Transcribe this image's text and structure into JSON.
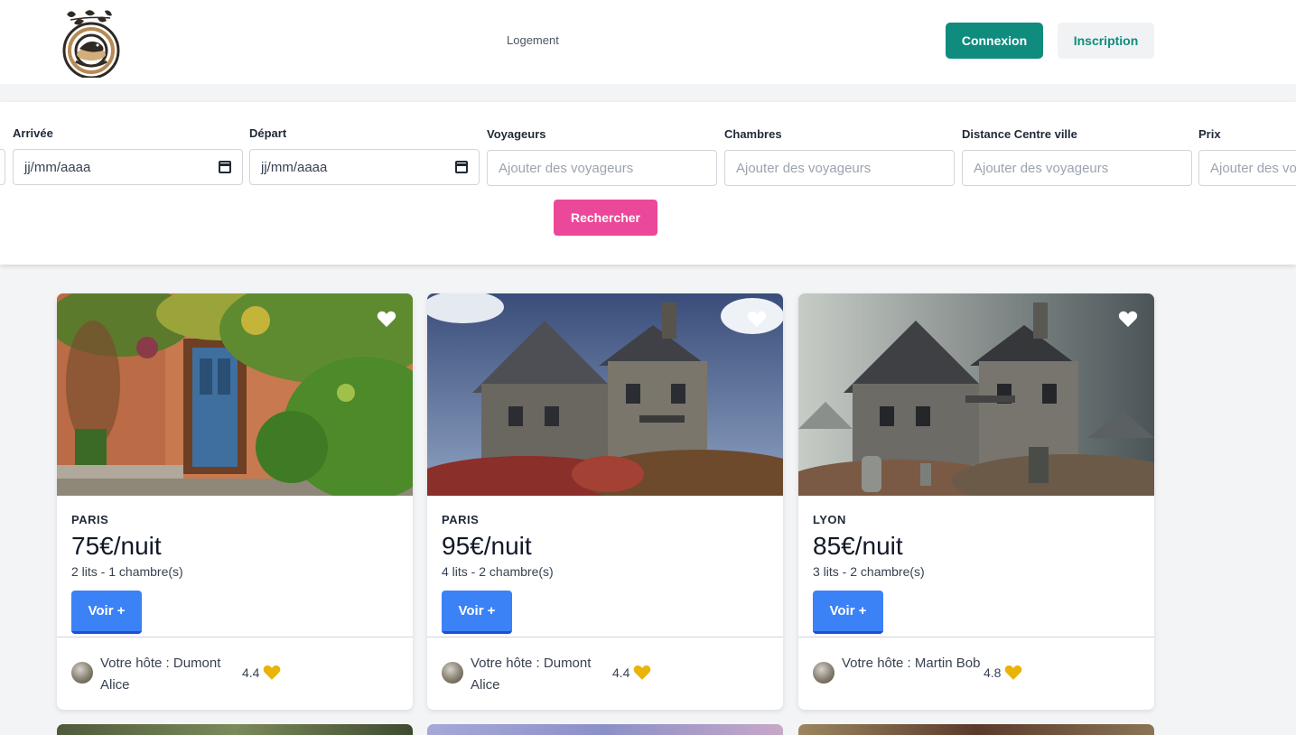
{
  "header": {
    "nav_link": "Logement",
    "login_label": "Connexion",
    "signup_label": "Inscription"
  },
  "search": {
    "fields": [
      {
        "label": "Arrivée",
        "value": "jj/mm/aaaa",
        "icon": "calendar-icon"
      },
      {
        "label": "Départ",
        "value": "jj/mm/aaaa",
        "icon": "calendar-icon"
      },
      {
        "label": "Voyageurs",
        "placeholder": "Ajouter des voyageurs"
      },
      {
        "label": "Chambres",
        "placeholder": "Ajouter des voyageurs"
      },
      {
        "label": "Distance Centre ville",
        "placeholder": "Ajouter des voyageurs"
      },
      {
        "label": "Prix",
        "placeholder": "Ajouter des vo"
      }
    ],
    "button_label": "Rechercher"
  },
  "listings": [
    {
      "city": "PARIS",
      "price": "75€/nuit",
      "beds": "2 lits - 1 chambre(s)",
      "button": "Voir +",
      "host": "Votre hôte : Dumont Alice",
      "rating": "4.4"
    },
    {
      "city": "PARIS",
      "price": "95€/nuit",
      "beds": "4 lits - 2 chambre(s)",
      "button": "Voir +",
      "host": "Votre hôte : Dumont Alice",
      "rating": "4.4"
    },
    {
      "city": "LYON",
      "price": "85€/nuit",
      "beds": "3 lits - 2 chambre(s)",
      "button": "Voir +",
      "host": "Votre hôte : Martin Bob",
      "rating": "4.8"
    }
  ],
  "colors": {
    "brand": "#0f8c7e",
    "search_button": "#ec4899",
    "primary_button": "#3b82f6",
    "rating_heart": "#eab308"
  },
  "icons": {
    "favorite": "heart-outline-icon",
    "rating": "heart-icon",
    "date": "calendar-icon"
  }
}
